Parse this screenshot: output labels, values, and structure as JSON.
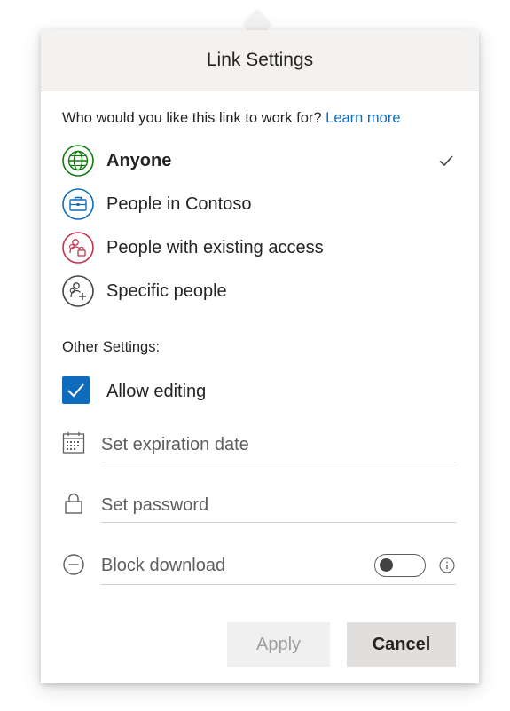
{
  "dialog": {
    "title": "Link Settings"
  },
  "audience": {
    "prompt": "Who would you like this link to work for?",
    "learn_more": "Learn more",
    "options": [
      {
        "label": "Anyone",
        "icon": "globe-icon",
        "color": "#107c10",
        "selected": true
      },
      {
        "label": "People in Contoso",
        "icon": "briefcase-icon",
        "color": "#0f6cbd",
        "selected": false
      },
      {
        "label": "People with existing access",
        "icon": "people-lock-icon",
        "color": "#c4314b",
        "selected": false
      },
      {
        "label": "Specific people",
        "icon": "people-add-icon",
        "color": "#424242",
        "selected": false
      }
    ]
  },
  "other_settings": {
    "label": "Other Settings:",
    "allow_editing": {
      "label": "Allow editing",
      "checked": true
    },
    "expiration": {
      "placeholder": "Set expiration date",
      "icon": "calendar-icon"
    },
    "password": {
      "placeholder": "Set password",
      "icon": "lock-icon"
    },
    "block_download": {
      "label": "Block download",
      "icon": "block-icon",
      "enabled": false
    }
  },
  "buttons": {
    "apply": "Apply",
    "cancel": "Cancel"
  },
  "colors": {
    "accent": "#0f6cbd",
    "header_bg": "#f3f2f1"
  }
}
